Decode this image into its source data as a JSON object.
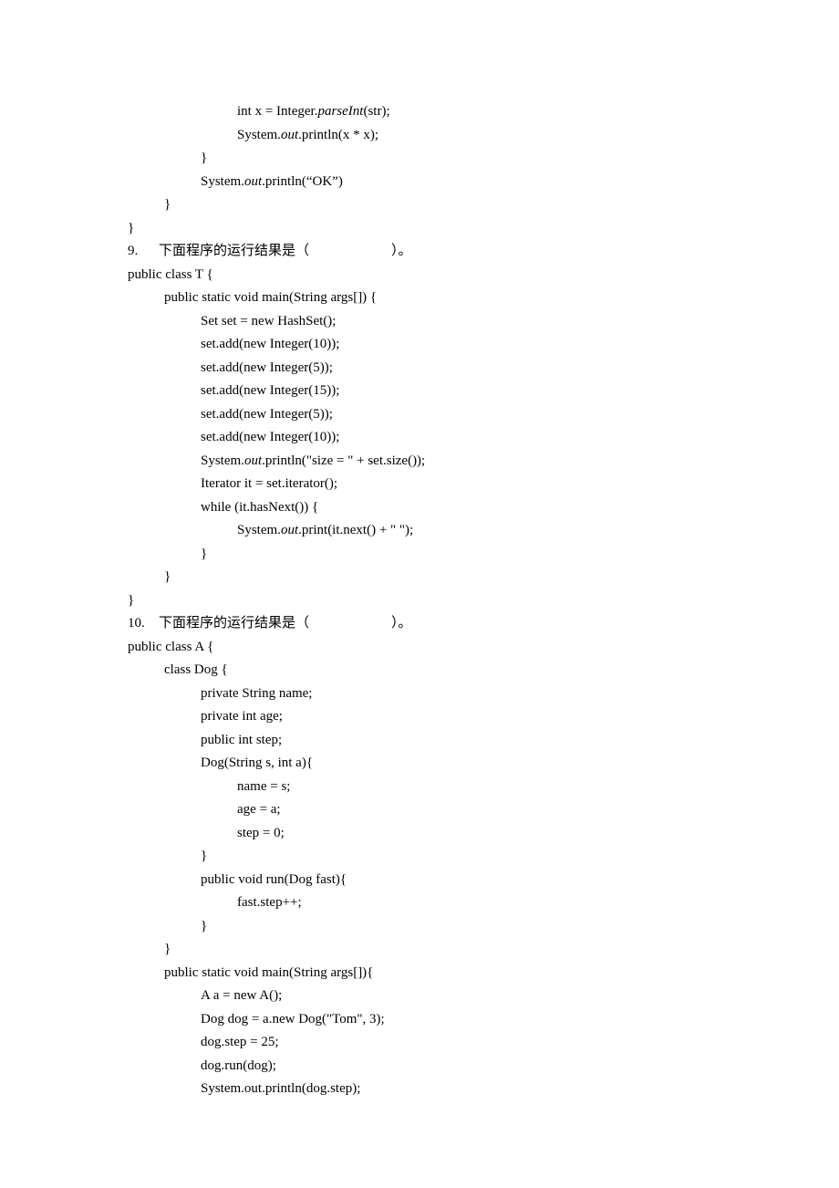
{
  "intro_block": {
    "lines": [
      {
        "indent": 3,
        "segments": [
          {
            "t": "int x = Integer."
          },
          {
            "t": "parseInt",
            "style": "italic"
          },
          {
            "t": "(str);"
          }
        ]
      },
      {
        "indent": 3,
        "segments": [
          {
            "t": "System."
          },
          {
            "t": "out",
            "style": "italic"
          },
          {
            "t": ".println(x * x);"
          }
        ]
      },
      {
        "indent": 2,
        "segments": [
          {
            "t": "}"
          }
        ]
      },
      {
        "indent": 2,
        "segments": [
          {
            "t": "System."
          },
          {
            "t": "out",
            "style": "italic"
          },
          {
            "t": ".println(“OK”)"
          }
        ]
      },
      {
        "indent": 1,
        "segments": [
          {
            "t": "}"
          }
        ]
      },
      {
        "indent": 0,
        "segments": [
          {
            "t": "}"
          }
        ]
      }
    ]
  },
  "questions": [
    {
      "number": "9.",
      "prompt_prefix": "下面程序的运行结果是（",
      "prompt_gap": "                        ",
      "prompt_suffix": "）。",
      "code": [
        {
          "indent": 0,
          "segments": [
            {
              "t": "public class T {"
            }
          ]
        },
        {
          "indent": 1,
          "segments": [
            {
              "t": "public static void main(String args[]) {"
            }
          ]
        },
        {
          "indent": 2,
          "segments": [
            {
              "t": "Set set = new HashSet();"
            }
          ]
        },
        {
          "indent": 2,
          "segments": [
            {
              "t": "set.add(new Integer(10));"
            }
          ]
        },
        {
          "indent": 2,
          "segments": [
            {
              "t": "set.add(new Integer(5));"
            }
          ]
        },
        {
          "indent": 2,
          "segments": [
            {
              "t": "set.add(new Integer(15));"
            }
          ]
        },
        {
          "indent": 2,
          "segments": [
            {
              "t": "set.add(new Integer(5));"
            }
          ]
        },
        {
          "indent": 2,
          "segments": [
            {
              "t": "set.add(new Integer(10));"
            }
          ]
        },
        {
          "indent": 2,
          "segments": [
            {
              "t": "System."
            },
            {
              "t": "out",
              "style": "italic"
            },
            {
              "t": ".println(\"size = \" + set.size());"
            }
          ]
        },
        {
          "indent": 2,
          "segments": [
            {
              "t": "Iterator it = set.iterator();"
            }
          ]
        },
        {
          "indent": 2,
          "segments": [
            {
              "t": "while (it.hasNext()) {"
            }
          ]
        },
        {
          "indent": 3,
          "segments": [
            {
              "t": "System."
            },
            {
              "t": "out",
              "style": "italic"
            },
            {
              "t": ".print(it.next() + \" \");"
            }
          ]
        },
        {
          "indent": 2,
          "segments": [
            {
              "t": "}"
            }
          ]
        },
        {
          "indent": 1,
          "segments": [
            {
              "t": "}"
            }
          ]
        },
        {
          "indent": 0,
          "segments": [
            {
              "t": "}"
            }
          ]
        }
      ]
    },
    {
      "number": "10.",
      "prompt_prefix": "下面程序的运行结果是（",
      "prompt_gap": "                        ",
      "prompt_suffix": "）。",
      "code": [
        {
          "indent": 0,
          "segments": [
            {
              "t": "public class A {"
            }
          ]
        },
        {
          "indent": 1,
          "segments": [
            {
              "t": "class Dog {"
            }
          ]
        },
        {
          "indent": 2,
          "segments": [
            {
              "t": "private String name;"
            }
          ]
        },
        {
          "indent": 2,
          "segments": [
            {
              "t": "private int age;"
            }
          ]
        },
        {
          "indent": 2,
          "segments": [
            {
              "t": "public int step;"
            }
          ]
        },
        {
          "indent": 2,
          "segments": [
            {
              "t": "Dog(String s, int a){"
            }
          ]
        },
        {
          "indent": 3,
          "segments": [
            {
              "t": "name = s;"
            }
          ]
        },
        {
          "indent": 3,
          "segments": [
            {
              "t": "age = a;"
            }
          ]
        },
        {
          "indent": 3,
          "segments": [
            {
              "t": "step = 0;"
            }
          ]
        },
        {
          "indent": 2,
          "segments": [
            {
              "t": "}"
            }
          ]
        },
        {
          "indent": 2,
          "segments": [
            {
              "t": "public void run(Dog fast){"
            }
          ]
        },
        {
          "indent": 3,
          "segments": [
            {
              "t": "fast.step++;"
            }
          ]
        },
        {
          "indent": 2,
          "segments": [
            {
              "t": "}"
            }
          ]
        },
        {
          "indent": 1,
          "segments": [
            {
              "t": "}"
            }
          ]
        },
        {
          "indent": 1,
          "segments": [
            {
              "t": "public static void main(String args[]){"
            }
          ]
        },
        {
          "indent": 2,
          "segments": [
            {
              "t": "A a = new A();"
            }
          ]
        },
        {
          "indent": 2,
          "segments": [
            {
              "t": "Dog dog = a.new Dog(\"Tom\", 3);"
            }
          ]
        },
        {
          "indent": 2,
          "segments": [
            {
              "t": "dog.step = 25;"
            }
          ]
        },
        {
          "indent": 2,
          "segments": [
            {
              "t": "dog.run(dog);"
            }
          ]
        },
        {
          "indent": 2,
          "segments": [
            {
              "t": "System.out.println(dog.step);"
            }
          ]
        }
      ]
    }
  ]
}
